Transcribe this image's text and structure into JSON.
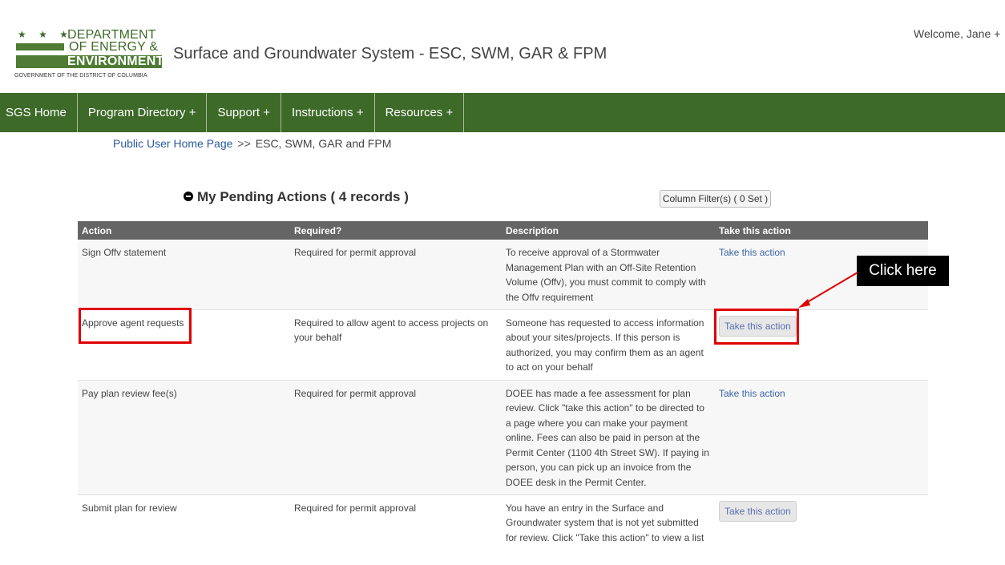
{
  "header": {
    "logo": {
      "line1": "DEPARTMENT",
      "line2": "OF ENERGY &",
      "line3": "ENVIRONMENT",
      "tagline": "GOVERNMENT OF THE DISTRICT OF COLUMBIA",
      "stars": "★ ★ ★"
    },
    "app_title": "Surface and Groundwater System - ESC, SWM, GAR & FPM",
    "welcome": "Welcome, Jane +"
  },
  "nav": {
    "items": [
      "SGS Home",
      "Program Directory +",
      "Support +",
      "Instructions +",
      "Resources +"
    ]
  },
  "breadcrumb": {
    "link": "Public User Home Page",
    "separator": ">>",
    "current": "ESC, SWM, GAR and FPM"
  },
  "pending": {
    "title": "My Pending Actions ( 4 records )",
    "column_filter": "Column Filter(s) ( 0 Set )",
    "columns": [
      "Action",
      "Required?",
      "Description",
      "Take this action"
    ],
    "rows": [
      {
        "action": "Sign Offv statement",
        "required": "Required for permit approval",
        "description": "To receive approval of a Stormwater Management Plan with an Off-Site Retention Volume (Offv), you must commit to comply with the Offv requirement",
        "take": "Take this action"
      },
      {
        "action": "Approve agent requests",
        "required": "Required to allow agent to access projects on your behalf",
        "description": "Someone has requested to access information about your sites/projects. If this person is authorized, you may confirm them as an agent to act on your behalf",
        "take": "Take this action"
      },
      {
        "action": "Pay plan review fee(s)",
        "required": "Required for permit approval",
        "description": "DOEE has made a fee assessment for plan review. Click \"take this action\" to be directed to a page where you can make your payment online. Fees can also be paid in person at the Permit Center (1100 4th Street SW). If paying in person, you can pick up an invoice from the DOEE desk in the Permit Center.",
        "take": "Take this action"
      },
      {
        "action": "Submit plan for review",
        "required": "Required for permit approval",
        "description": "You have an entry in the Surface and Groundwater system that is not yet submitted for review. Click \"Take this action\" to view a list",
        "take": "Take this action"
      }
    ]
  },
  "annotation": {
    "callout": "Click here",
    "color": "#e00000"
  }
}
